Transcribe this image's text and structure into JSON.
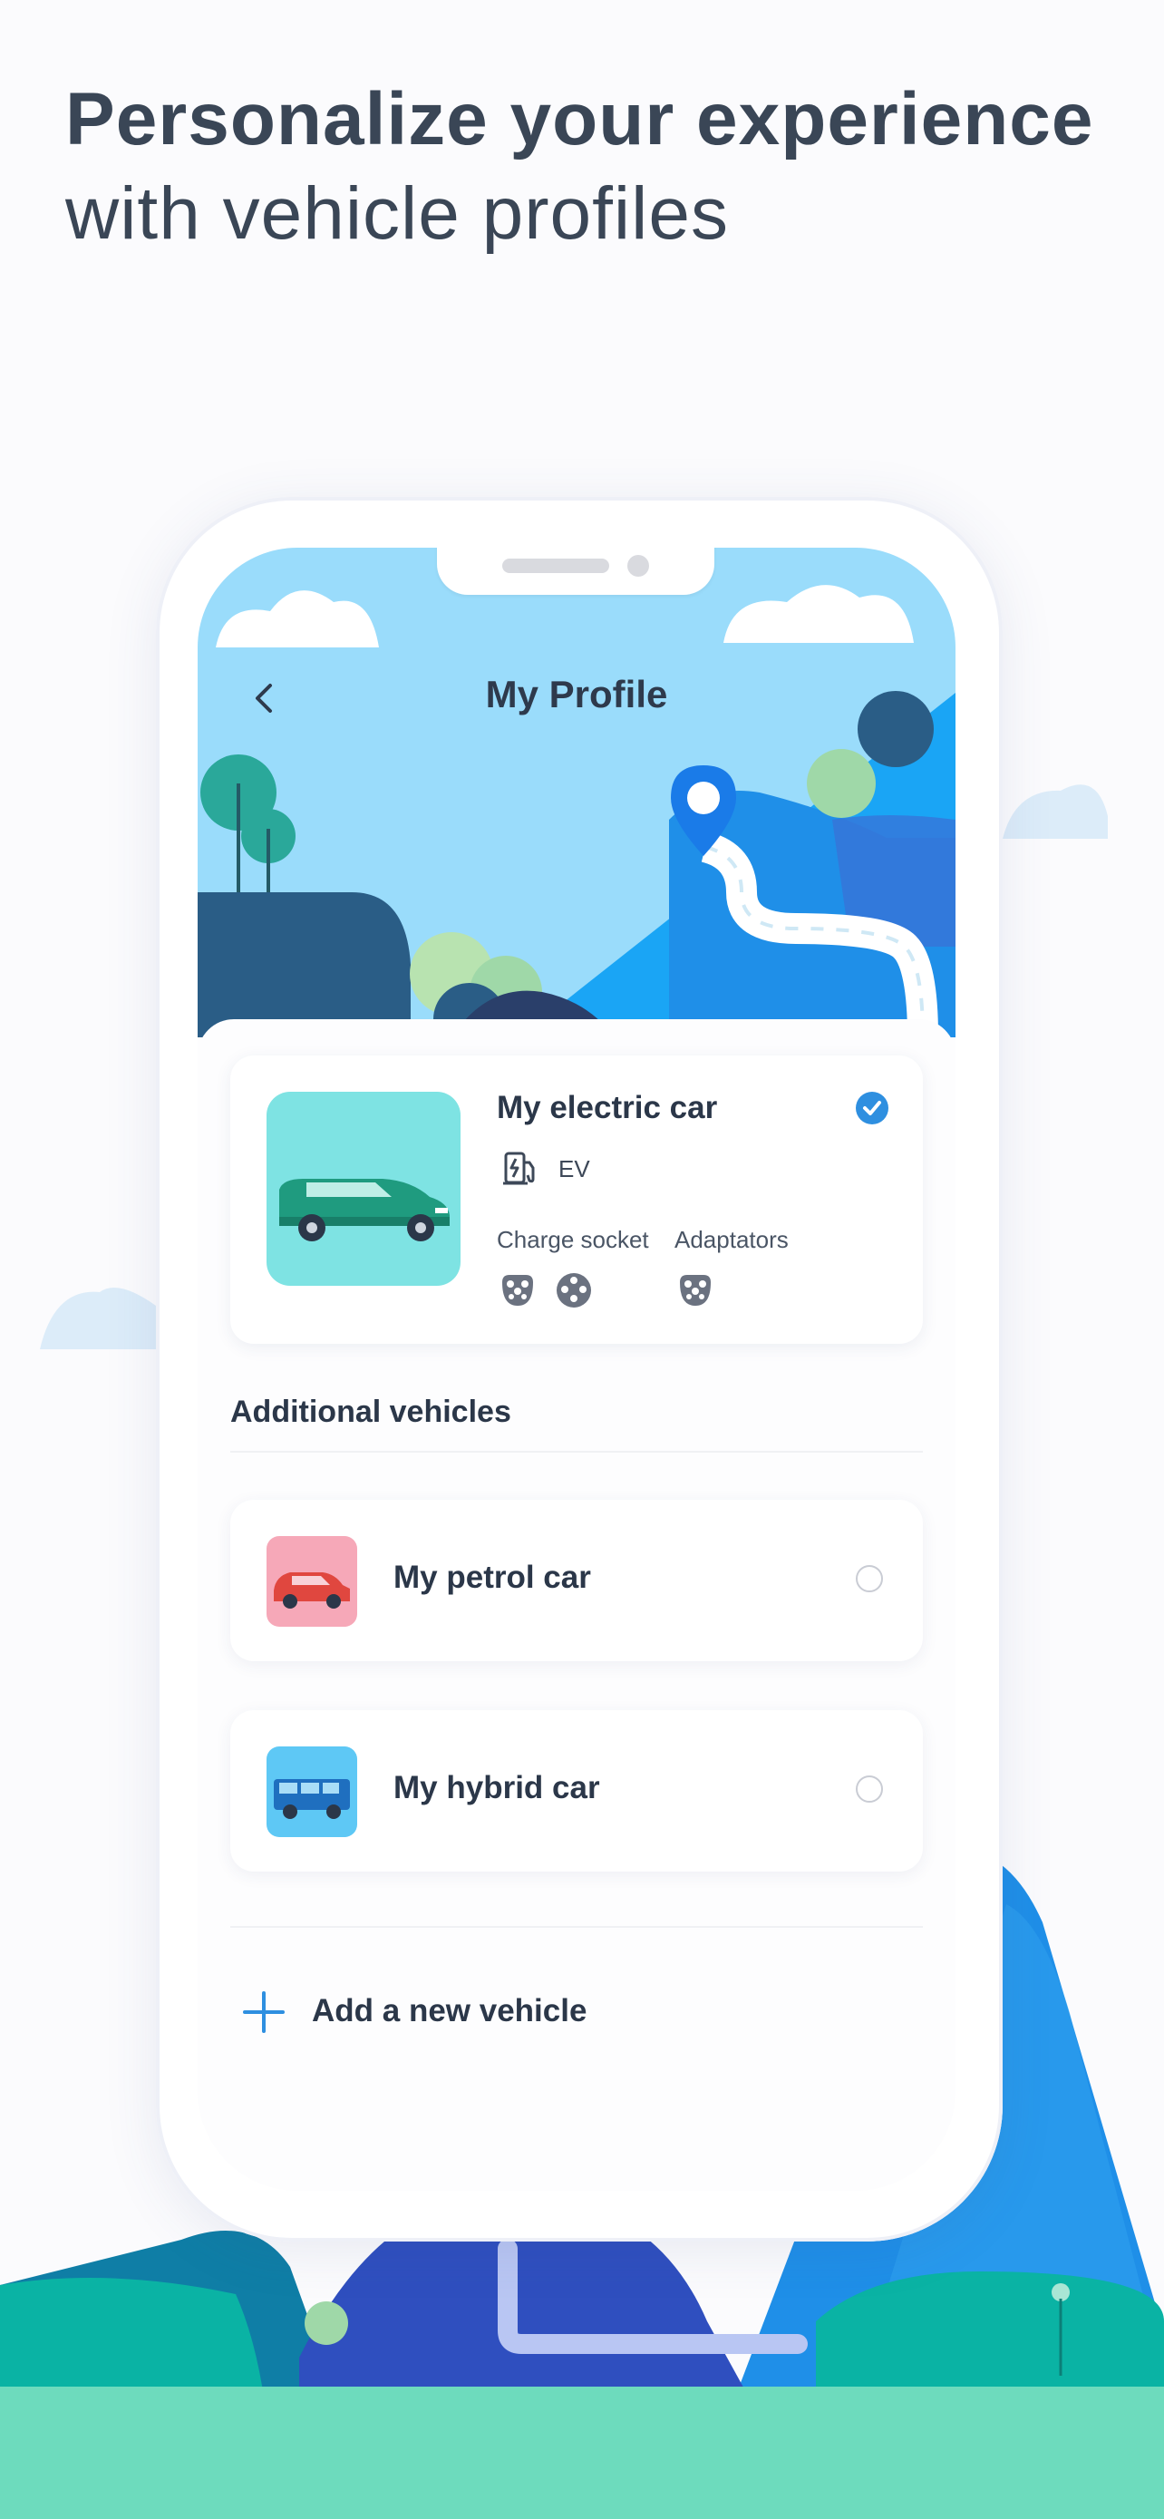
{
  "headline": {
    "bold": "Personalize your experience",
    "light": "with vehicle profiles"
  },
  "header": {
    "title": "My Profile"
  },
  "main_vehicle": {
    "name": "My electric car",
    "fuel_type": "EV",
    "charge_socket_label": "Charge socket",
    "adaptators_label": "Adaptators",
    "selected": true
  },
  "additional": {
    "title": "Additional vehicles",
    "vehicles": [
      {
        "name": "My petrol car",
        "selected": false,
        "color": "#f6a8b8"
      },
      {
        "name": "My hybrid car",
        "selected": false,
        "color": "#5ec8f5"
      }
    ]
  },
  "add_vehicle": {
    "label": "Add a new vehicle"
  },
  "colors": {
    "accent": "#2e8fe0",
    "sky": "#9adcfb",
    "mountain_blue": "#1aa5f5",
    "ground_green": "#6ddbbd"
  }
}
